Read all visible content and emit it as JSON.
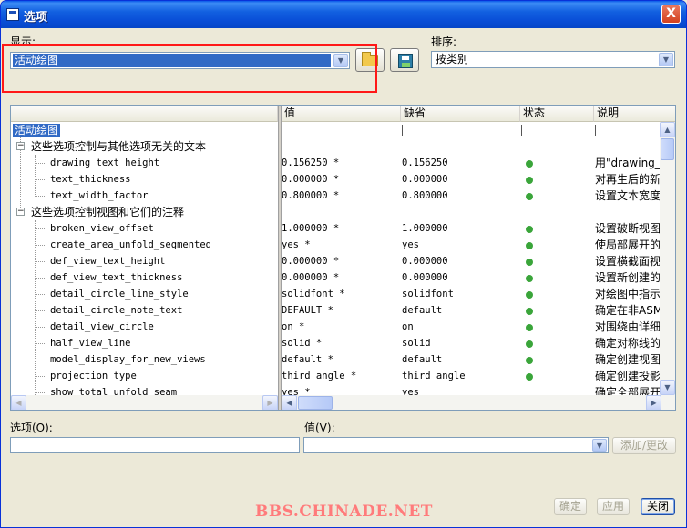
{
  "window": {
    "title": "选项",
    "close_label": "X"
  },
  "display": {
    "label": "显示:",
    "value": "活动绘图"
  },
  "sort": {
    "label": "排序:",
    "value": "按类别"
  },
  "columns": {
    "value": "值",
    "default": "缺省",
    "status": "状态",
    "description": "说明"
  },
  "tree": {
    "root": "活动绘图",
    "sections": [
      {
        "title": "这些选项控制与其他选项无关的文本",
        "rows": [
          {
            "name": "drawing_text_height",
            "value": "0.156250 *",
            "default": "0.156250",
            "desc": "用\"drawing_u"
          },
          {
            "name": "text_thickness",
            "value": "0.000000 *",
            "default": "0.000000",
            "desc": "对再生后的新"
          },
          {
            "name": "text_width_factor",
            "value": "0.800000 *",
            "default": "0.800000",
            "desc": "设置文本宽度"
          }
        ]
      },
      {
        "title": "这些选项控制视图和它们的注释",
        "rows": [
          {
            "name": "broken_view_offset",
            "value": "1.000000 *",
            "default": "1.000000",
            "desc": "设置破断视图"
          },
          {
            "name": "create_area_unfold_segmented",
            "value": "yes *",
            "default": "yes",
            "desc": "使局部展开的"
          },
          {
            "name": "def_view_text_height",
            "value": "0.000000 *",
            "default": "0.000000",
            "desc": "设置横截面视"
          },
          {
            "name": "def_view_text_thickness",
            "value": "0.000000 *",
            "default": "0.000000",
            "desc": "设置新创建的"
          },
          {
            "name": "detail_circle_line_style",
            "value": "solidfont *",
            "default": "solidfont",
            "desc": "对绘图中指示"
          },
          {
            "name": "detail_circle_note_text",
            "value": "DEFAULT *",
            "default": "default",
            "desc": "确定在非ASME"
          },
          {
            "name": "detail_view_circle",
            "value": "on *",
            "default": "on",
            "desc": "对围绕由详细"
          },
          {
            "name": "half_view_line",
            "value": "solid *",
            "default": "solid",
            "desc": "确定对称线的"
          },
          {
            "name": "model_display_for_new_views",
            "value": "default *",
            "default": "default",
            "desc": "确定创建视图"
          },
          {
            "name": "projection_type",
            "value": "third_angle *",
            "default": "third_angle",
            "desc": "确定创建投影"
          },
          {
            "name": "show_total_unfold_seam",
            "value": "yes *",
            "default": "yes",
            "desc": "确定全部展开"
          }
        ]
      }
    ]
  },
  "option_field": {
    "label": "选项(O):",
    "value": ""
  },
  "value_field": {
    "label": "值(V):",
    "value": ""
  },
  "buttons": {
    "add_change": "添加/更改",
    "ok": "确定",
    "apply": "应用",
    "close": "关闭"
  },
  "watermark": "BBS.CHINADE.NET",
  "colors": {
    "status_ok": "#3aa53a",
    "selection": "#316ac5",
    "highlight_box": "#ff1818",
    "titlebar": "#0a4fd8"
  }
}
